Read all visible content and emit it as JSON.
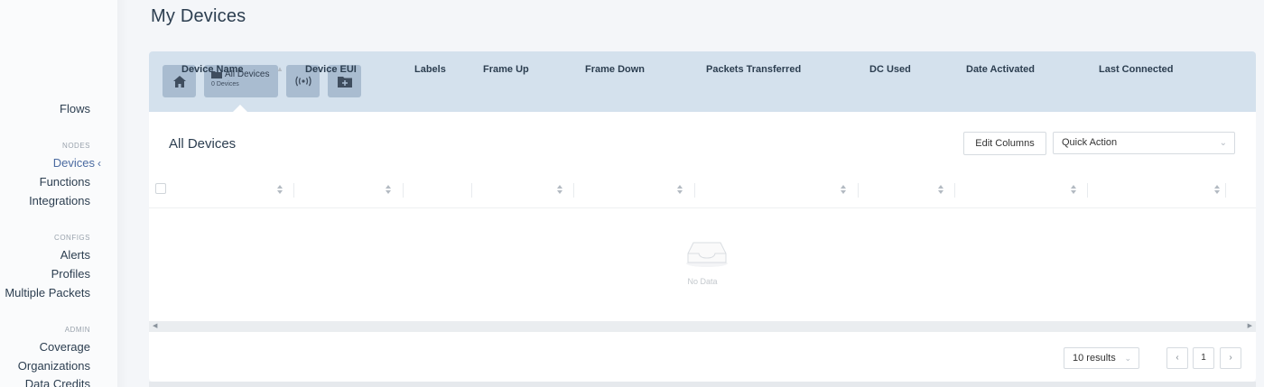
{
  "sidebar": {
    "top_item": "Flows",
    "sections": [
      {
        "title": "NODES",
        "items": [
          "Devices",
          "Functions",
          "Integrations"
        ]
      },
      {
        "title": "CONFIGS",
        "items": [
          "Alerts",
          "Profiles",
          "Multiple Packets"
        ]
      },
      {
        "title": "ADMIN",
        "items": [
          "Coverage",
          "Organizations",
          "Data Credits"
        ]
      }
    ],
    "active_item": "Devices",
    "active_chevron": "‹"
  },
  "page": {
    "title": "My Devices"
  },
  "filters": {
    "all_devices": {
      "label": "All Devices",
      "count": "0 Devices"
    }
  },
  "panel": {
    "title": "All Devices",
    "edit_columns": "Edit Columns",
    "quick_action": "Quick Action"
  },
  "table": {
    "columns": [
      "Device Name",
      "Device EUI",
      "Labels",
      "Frame Up",
      "Frame Down",
      "Packets Transferred",
      "DC Used",
      "Date Activated",
      "Last Connected"
    ],
    "empty_text": "No Data"
  },
  "pagination": {
    "page_size": "10 results",
    "current_page": "1",
    "prev": "‹",
    "next": "›"
  },
  "icons": {
    "home": "home-icon",
    "folder": "folder-icon",
    "radio": "radio-signal-icon",
    "add_folder": "folder-plus-icon",
    "empty": "inbox-icon"
  },
  "colors": {
    "header_band": "#d4e1ed",
    "tile": "#a9bcd0",
    "active_nav": "#4a6aa0"
  }
}
